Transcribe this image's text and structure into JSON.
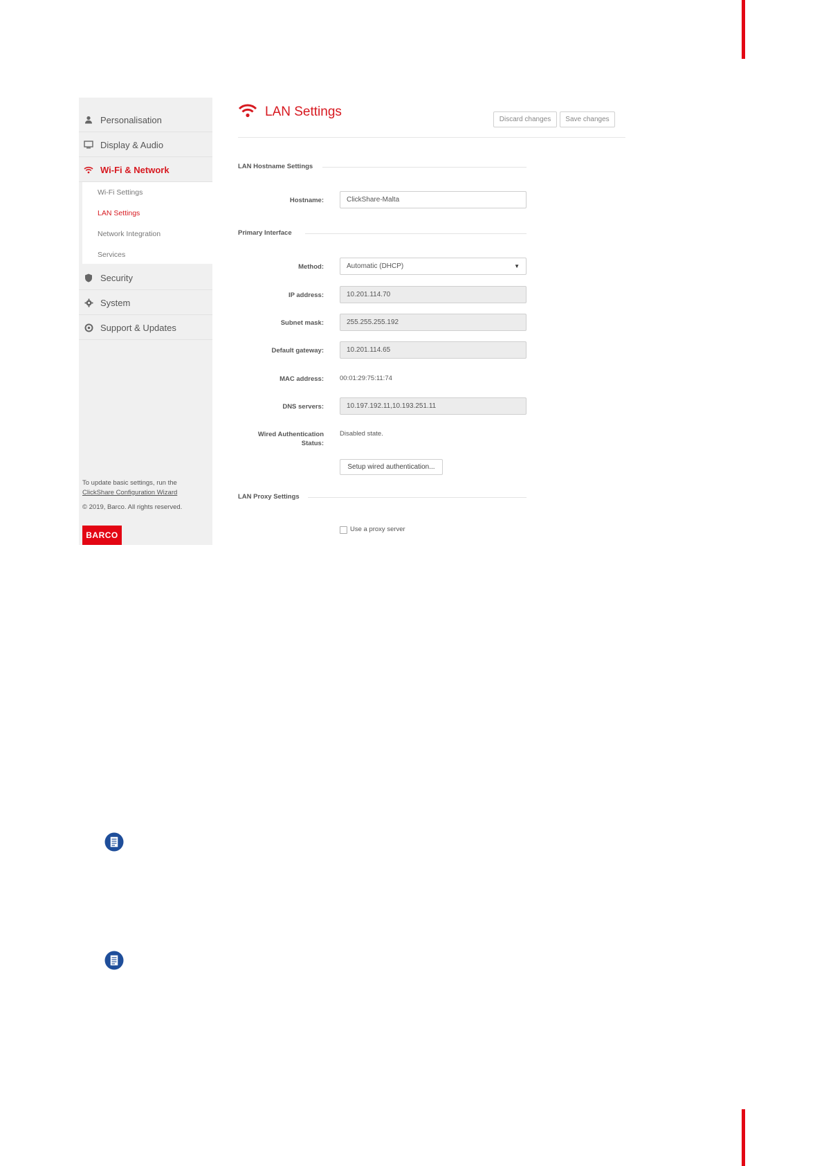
{
  "sidebar": {
    "items": [
      {
        "label": "Personalisation"
      },
      {
        "label": "Display & Audio"
      },
      {
        "label": "Wi-Fi & Network"
      },
      {
        "label": "Security"
      },
      {
        "label": "System"
      },
      {
        "label": "Support & Updates"
      }
    ],
    "subitems": [
      {
        "label": "Wi-Fi Settings"
      },
      {
        "label": "LAN Settings"
      },
      {
        "label": "Network Integration"
      },
      {
        "label": "Services"
      }
    ],
    "note_text": "To update basic settings, run the",
    "note_link": "ClickShare Configuration Wizard",
    "copyright": "© 2019, Barco. All rights reserved.",
    "logo": "BARCO"
  },
  "header": {
    "title": "LAN Settings",
    "discard_label": "Discard changes",
    "save_label": "Save changes"
  },
  "sections": {
    "hostname": "LAN Hostname Settings",
    "primary": "Primary Interface",
    "proxy": "LAN Proxy Settings"
  },
  "form": {
    "hostname_label": "Hostname:",
    "hostname_value": "ClickShare-Malta",
    "method_label": "Method:",
    "method_value": "Automatic (DHCP)",
    "ip_label": "IP address:",
    "ip_value": "10.201.114.70",
    "subnet_label": "Subnet mask:",
    "subnet_value": "255.255.255.192",
    "gateway_label": "Default gateway:",
    "gateway_value": "10.201.114.65",
    "mac_label": "MAC address:",
    "mac_value": "00:01:29:75:11:74",
    "dns_label": "DNS servers:",
    "dns_value": "10.197.192.11,10.193.251.11",
    "wired_label_1": "Wired Authentication",
    "wired_label_2": "Status:",
    "wired_value": "Disabled state.",
    "setup_wired_label": "Setup wired authentication...",
    "proxy_checkbox_label": "Use a proxy server"
  },
  "colors": {
    "accent": "#d71920",
    "brand": "#e30613",
    "note_icon": "#1f4e9a"
  }
}
